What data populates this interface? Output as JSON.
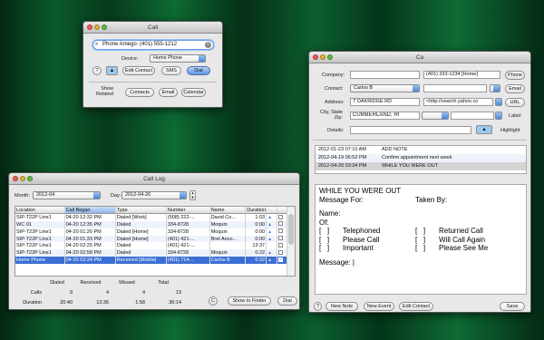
{
  "call_window": {
    "title": "Call",
    "number_field": "Phone Amego: (401) 555-1212",
    "device_label": "Device:",
    "device_value": "Home Phone",
    "help": "?",
    "btn_edit": "Edit Contact",
    "btn_sms": "SMS",
    "btn_dial": "Dial",
    "show_related": "Show\nRelated",
    "btn_contacts": "Contacts",
    "btn_email": "Email",
    "btn_calendar": "Calendar"
  },
  "contact_window": {
    "title": "Ca",
    "company_label": "Company:",
    "phone_value": "(401) 333-1234 [Home]",
    "btn_phone": "Phone",
    "contact_label": "Contact:",
    "contact_value": "Carlos B",
    "btn_email": "Email",
    "address_label": "Address:",
    "address_value": "7 OAKRIDGE RD",
    "url_value": "<http://search.yahoo.co",
    "btn_url": "URL",
    "city_label": "City, State\nZip:",
    "city_value": "CUMBERLAND, RI",
    "label_text": "Label",
    "details_label": "Details:",
    "highlight_text": "Highlight",
    "notes": [
      {
        "date": "2012-01-23 07:10 AM",
        "text": "ADD NOTE"
      },
      {
        "date": "2012-04-19 06:52 PM",
        "text": "Confirm appointment next week"
      },
      {
        "date": "2012-04-20 03:34 PM",
        "text": "WHILE YOU WERE OUT"
      }
    ],
    "memo": {
      "heading": "WHILE YOU WERE OUT",
      "for": "Message For:",
      "taken": "Taken By:",
      "name": "Name:",
      "of": "Of:",
      "tel": "Telephoned",
      "returned": "Returned Call",
      "please": "Please Call",
      "callagain": "Will Call Again",
      "important": "Important",
      "seeme": "Please See Me",
      "message": "Message:",
      "box": "[   ]"
    },
    "help": "?",
    "btn_new_note": "New Note",
    "btn_new_event": "New Event",
    "btn_edit_contact": "Edit Contact",
    "btn_save": "Save"
  },
  "call_log": {
    "title": "Call Log",
    "month_label": "Month:",
    "month_value": "2012-04",
    "day_label": "Day:",
    "day_value": "2012-04-20",
    "columns": [
      "Location",
      "Call Began",
      "Type",
      "Number",
      "Name",
      "Duration"
    ],
    "rows": [
      {
        "loc": "SIP-T22P Line1",
        "began": "04-20 12:32 PM",
        "type": "Dialed [Work]",
        "num": "(508) 222-...",
        "name": "David Co...",
        "dur": "1:03"
      },
      {
        "loc": "WC 01",
        "began": "04-20 12:35 PM",
        "type": "Dialed",
        "num": "334-8728",
        "name": "Moquin",
        "dur": "0:00"
      },
      {
        "loc": "SIP-T22P Line1",
        "began": "04-20 01:26 PM",
        "type": "Dialed [Home]",
        "num": "334-8728",
        "name": "Moquin",
        "dur": "0:00"
      },
      {
        "loc": "SIP-T22P Line1",
        "began": "04-20 01:33 PM",
        "type": "Dialed [Home]",
        "num": "(401) 421-...",
        "name": "Bret Anco...",
        "dur": "0:00"
      },
      {
        "loc": "SIP-T22P Line1",
        "began": "04-20 02:25 PM",
        "type": "Dialed",
        "num": "(401) 421-...",
        "name": "",
        "dur": "13:37"
      },
      {
        "loc": "SIP-T22P Line1",
        "began": "04-20 02:58 PM",
        "type": "Dialed",
        "num": "334-8728",
        "name": "Moquin",
        "dur": "0:22"
      },
      {
        "loc": "Home Phone",
        "began": "04-20 03:34 PM",
        "type": "Received [Mobile]",
        "num": "(401) 714-...",
        "name": "Carlos B",
        "dur": "0:22"
      }
    ],
    "totals": {
      "h_dialed": "Dialed",
      "h_received": "Received",
      "h_missed": "Missed",
      "h_total": "Total",
      "calls_label": "Calls",
      "calls": [
        "9",
        "4",
        "4",
        "13"
      ],
      "dur_label": "Duration",
      "durs": [
        "20:40",
        "13:36",
        "1:58",
        "36:14"
      ]
    },
    "btn_c": "C",
    "btn_finder": "Show In Finder",
    "btn_dial": "Dial"
  }
}
